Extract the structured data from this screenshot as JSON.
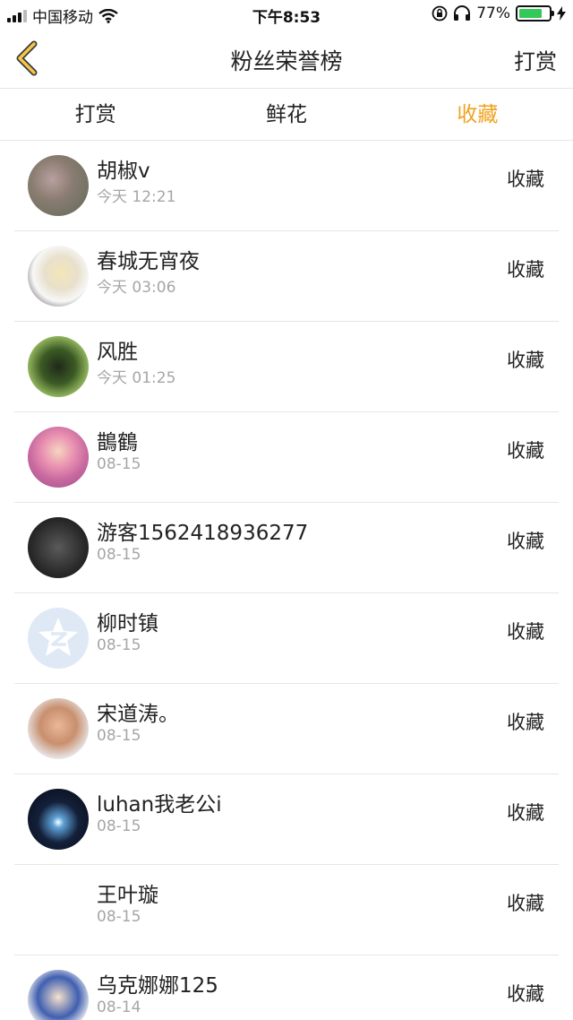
{
  "status_bar": {
    "carrier": "中国移动",
    "time": "下午8:53",
    "battery_percent": "77%",
    "battery_level": 0.77
  },
  "nav": {
    "title": "粉丝荣誉榜",
    "action": "打赏",
    "back_icon": "chevron-left-icon",
    "accent_color": "#f0a21d"
  },
  "tabs": [
    {
      "label": "打赏",
      "active": false
    },
    {
      "label": "鲜花",
      "active": false
    },
    {
      "label": "收藏",
      "active": true
    }
  ],
  "rows": [
    {
      "name": "胡椒v",
      "time": "今天 12:21",
      "action": "收藏"
    },
    {
      "name": "春城无宵夜",
      "time": "今天 03:06",
      "action": "收藏"
    },
    {
      "name": "风胜",
      "time": "今天 01:25",
      "action": "收藏"
    },
    {
      "name": "鵲鶴",
      "time": "08-15",
      "action": "收藏"
    },
    {
      "name": "游客1562418936277",
      "time": "08-15",
      "action": "收藏"
    },
    {
      "name": "柳时镇",
      "time": "08-15",
      "action": "收藏"
    },
    {
      "name": "宋道涛。",
      "time": "08-15",
      "action": "收藏"
    },
    {
      "name": "luhan我老公i",
      "time": "08-15",
      "action": "收藏"
    },
    {
      "name": "王叶璇",
      "time": "08-15",
      "action": "收藏"
    },
    {
      "name": "乌克娜娜125",
      "time": "08-14",
      "action": "收藏"
    }
  ]
}
